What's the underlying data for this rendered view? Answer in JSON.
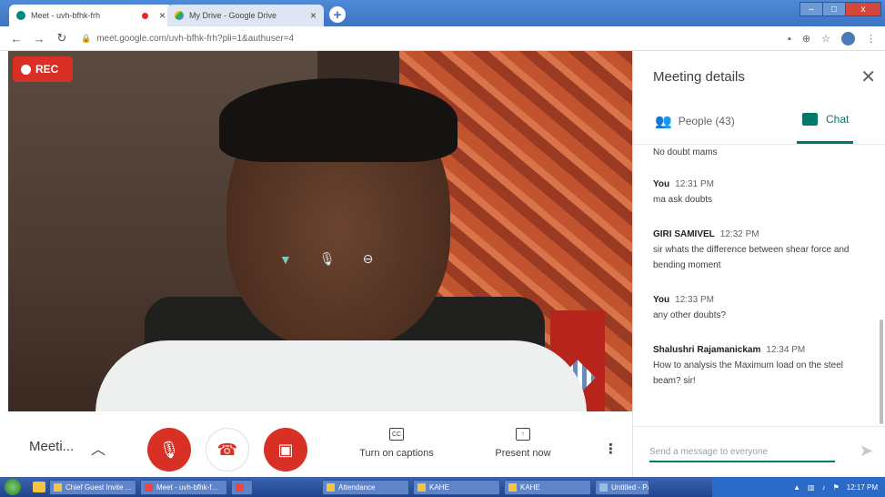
{
  "browser": {
    "tabs": [
      {
        "title": "Meet - uvh-bfhk-frh",
        "active": true
      },
      {
        "title": "My Drive - Google Drive",
        "active": false
      }
    ],
    "new_tab": "+",
    "url": "meet.google.com/uvh-bfhk-frh?pli=1&authuser=4",
    "window_controls": {
      "minimize": "–",
      "maximize": "□",
      "close": "x"
    }
  },
  "meeting": {
    "rec_label": "REC",
    "title": "Meeti...",
    "caption_label": "Turn on captions",
    "caption_icon_text": "CC",
    "present_label": "Present now"
  },
  "panel": {
    "title": "Meeting details",
    "people_tab": "People (43)",
    "chat_tab": "Chat",
    "pretext": "No doubt mams",
    "messages": [
      {
        "sender": "You",
        "time": "12:31 PM",
        "text": "ma ask doubts"
      },
      {
        "sender": "GIRI SAMIVEL",
        "time": "12:32 PM",
        "text": "sir whats the difference between shear force and bending moment"
      },
      {
        "sender": "You",
        "time": "12:33 PM",
        "text": "any other doubts?"
      },
      {
        "sender": "Shalushri Rajamanickam",
        "time": "12:34 PM",
        "text": "How to analysis the Maximum load on the steel beam? sir!"
      }
    ],
    "send_placeholder": "Send a message to everyone"
  },
  "taskbar": {
    "tasks": [
      "Chief Guest Invite ...",
      "Meet - uvh-bfhk-f...",
      "",
      "Attendance",
      "KAHE",
      "KAHE",
      "Untitled - Paint"
    ],
    "clock": "12:17 PM"
  },
  "colors": {
    "accent": "#00796b",
    "danger": "#d93025",
    "titlebar": "#3d74c4"
  }
}
